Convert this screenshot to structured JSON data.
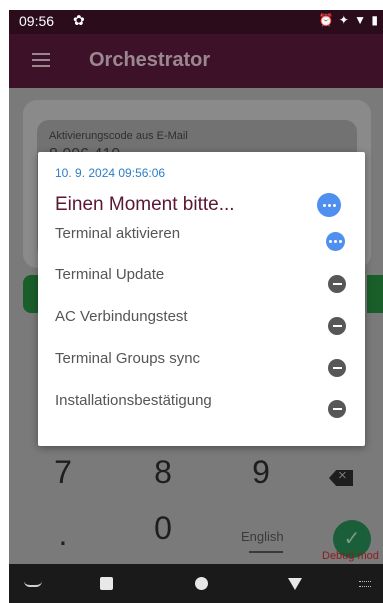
{
  "status_bar": {
    "time": "09:56",
    "right_icons": "⏰ ✦ ▼ ▮"
  },
  "app_bar": {
    "title": "Orchestrator"
  },
  "background": {
    "code_label": "Aktivierungscode aus E-Mail",
    "code_value": "8 096 410",
    "keypad": {
      "keys": [
        "7",
        "8",
        "9",
        ".",
        "0"
      ],
      "language": "English",
      "debug_label": "Debug mod"
    }
  },
  "dialog": {
    "timestamp": "10. 9. 2024 09:56:06",
    "title": "Einen Moment bitte...",
    "title_status": "pending",
    "steps": [
      {
        "label": "Terminal aktivieren",
        "status": "pending"
      },
      {
        "label": "Terminal Update",
        "status": "blocked"
      },
      {
        "label": "AC Verbindungstest",
        "status": "blocked"
      },
      {
        "label": "Terminal Groups sync",
        "status": "blocked"
      },
      {
        "label": "Installationsbestätigung",
        "status": "blocked"
      }
    ]
  },
  "colors": {
    "status_bar": "#2a0c1b",
    "app_bar": "#3d1229",
    "dialog_title": "#5a1733",
    "timestamp": "#2d7ec4",
    "pending_icon": "#4f8ff0",
    "blocked_icon": "#575757"
  }
}
